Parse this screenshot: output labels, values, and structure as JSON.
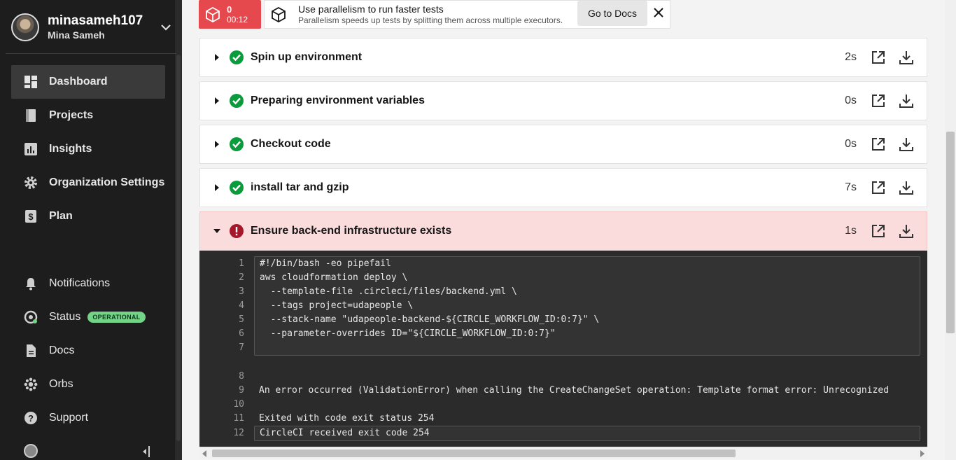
{
  "user": {
    "login": "minasameh107",
    "name": "Mina Sameh"
  },
  "nav": {
    "main": [
      {
        "label": "Dashboard",
        "icon": "dashboard-icon",
        "active": true
      },
      {
        "label": "Projects",
        "icon": "projects-icon"
      },
      {
        "label": "Insights",
        "icon": "insights-icon"
      },
      {
        "label": "Organization Settings",
        "icon": "gear-icon"
      },
      {
        "label": "Plan",
        "icon": "dollar-icon"
      }
    ],
    "secondary": [
      {
        "label": "Notifications",
        "icon": "bell-icon"
      },
      {
        "label": "Status",
        "icon": "status-icon",
        "badge": "OPERATIONAL"
      },
      {
        "label": "Docs",
        "icon": "docs-icon"
      },
      {
        "label": "Orbs",
        "icon": "orbs-icon"
      },
      {
        "label": "Support",
        "icon": "help-icon"
      }
    ]
  },
  "banner": {
    "failed_count": "0",
    "elapsed": "00:12",
    "tip_title": "Use parallelism to run faster tests",
    "tip_subtitle": "Parallelism speeds up tests by splitting them across multiple executors.",
    "docs_button": "Go to Docs"
  },
  "steps": [
    {
      "title": "Spin up environment",
      "duration": "2s",
      "status": "success"
    },
    {
      "title": "Preparing environment variables",
      "duration": "0s",
      "status": "success"
    },
    {
      "title": "Checkout code",
      "duration": "0s",
      "status": "success"
    },
    {
      "title": "install tar and gzip",
      "duration": "7s",
      "status": "success"
    },
    {
      "title": "Ensure back-end infrastructure exists",
      "duration": "1s",
      "status": "failed"
    }
  ],
  "output_lines": [
    {
      "n": "1",
      "text": "#!/bin/bash -eo pipefail"
    },
    {
      "n": "2",
      "text": "aws cloudformation deploy \\"
    },
    {
      "n": "3",
      "text": "  --template-file .circleci/files/backend.yml \\"
    },
    {
      "n": "4",
      "text": "  --tags project=udapeople \\"
    },
    {
      "n": "5",
      "text": "  --stack-name \"udapeople-backend-${CIRCLE_WORKFLOW_ID:0:7}\" \\"
    },
    {
      "n": "6",
      "text": "  --parameter-overrides ID=\"${CIRCLE_WORKFLOW_ID:0:7}\""
    },
    {
      "n": "7",
      "text": ""
    },
    {
      "n": "8",
      "text": ""
    },
    {
      "n": "9",
      "text": "An error occurred (ValidationError) when calling the CreateChangeSet operation: Template format error: Unrecognized"
    },
    {
      "n": "10",
      "text": ""
    },
    {
      "n": "11",
      "text": "Exited with code exit status 254"
    },
    {
      "n": "12",
      "text": "CircleCI received exit code 254"
    }
  ],
  "colors": {
    "success": "#0a9b3c",
    "failed": "#a6172a",
    "failed_bg": "#fbdcdc",
    "badge": "#73d387"
  }
}
